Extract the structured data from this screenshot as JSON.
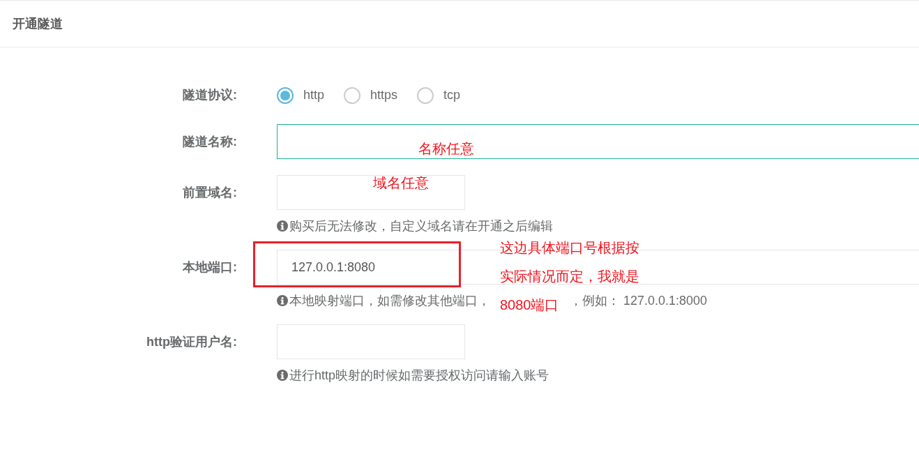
{
  "header": {
    "title": "开通隧道"
  },
  "form": {
    "fields": [
      {
        "kind": "radio",
        "label": "隧道协议:",
        "options": [
          {
            "label": "http",
            "selected": true
          },
          {
            "label": "https",
            "selected": false
          },
          {
            "label": "tcp",
            "selected": false
          }
        ]
      },
      {
        "kind": "wide",
        "label": "隧道名称:",
        "focused": true
      },
      {
        "kind": "short",
        "label": "前置域名:",
        "focused": false,
        "hint": [
          "购买后无法修改，自定义域名请在开通之后编辑"
        ]
      },
      {
        "kind": "wide",
        "label": "本地端口:",
        "value": "127.0.0.1:8080",
        "focused": false,
        "highlighted": true,
        "hint": [
          "本地映射端口，如需修改其他端口，",
          "，例如： 127.0.0.1:8000"
        ]
      },
      {
        "kind": "short",
        "label": "http验证用户名:",
        "focused": false,
        "hint": [
          "进行http映射的时候如需要授权访问请输入账号"
        ]
      }
    ]
  },
  "annotations": [
    {
      "lines": [
        "名称任意"
      ]
    },
    {
      "lines": [
        "域名任意"
      ]
    },
    {
      "lines": [
        "这边具体端口号根据按",
        "实际情况而定，我就是",
        "8080端口"
      ]
    }
  ]
}
